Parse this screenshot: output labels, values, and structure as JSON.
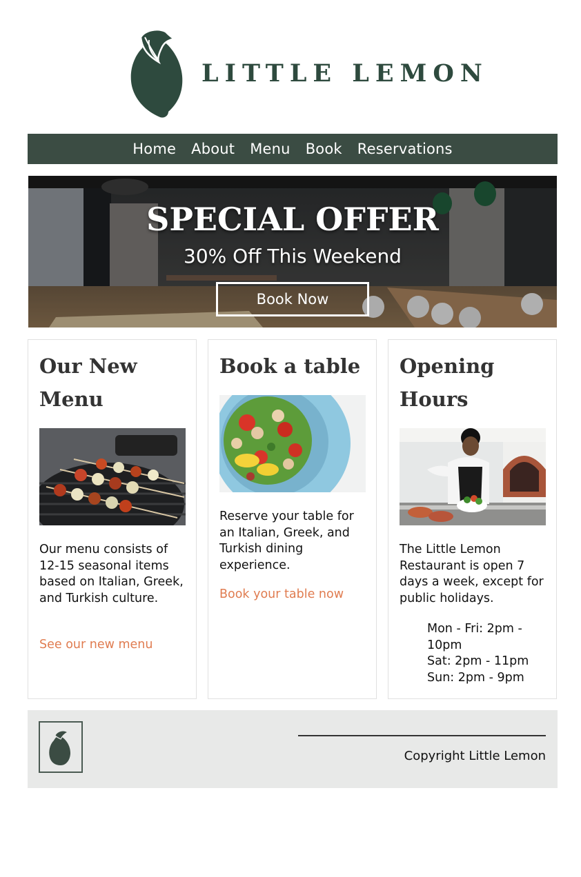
{
  "brand": {
    "name": "LITTLE LEMON",
    "color": "#2e4a3e",
    "logo_icon": "lemon-icon"
  },
  "nav": {
    "items": [
      {
        "label": "Home"
      },
      {
        "label": "About"
      },
      {
        "label": "Menu"
      },
      {
        "label": "Book"
      },
      {
        "label": "Reservations"
      }
    ],
    "background": "#3b4c43"
  },
  "hero": {
    "title": "SPECIAL OFFER",
    "subtitle": "30% Off This Weekend",
    "button_label": "Book Now"
  },
  "cards": [
    {
      "title": "Our New Menu",
      "image": "grilled-skewers-photo",
      "text": "Our menu consists of 12-15 seasonal items based on Italian, Greek, and Turkish culture.",
      "link": "See our new menu"
    },
    {
      "title": "Book a table",
      "image": "salad-bowl-photo",
      "text": "Reserve your table for an Italian, Greek, and Turkish dining experience.",
      "link": "Book your table now"
    },
    {
      "title": "Opening Hours",
      "image": "chef-plating-photo",
      "text": "The Little Lemon Restaurant is open 7 days a week, except for public holidays.",
      "hours": [
        "Mon - Fri: 2pm - 10pm",
        "Sat: 2pm - 11pm",
        "Sun: 2pm - 9pm"
      ]
    }
  ],
  "footer": {
    "copyright": "Copyright Little Lemon",
    "background": "#e8e9e8"
  },
  "accent": "#e07c50"
}
